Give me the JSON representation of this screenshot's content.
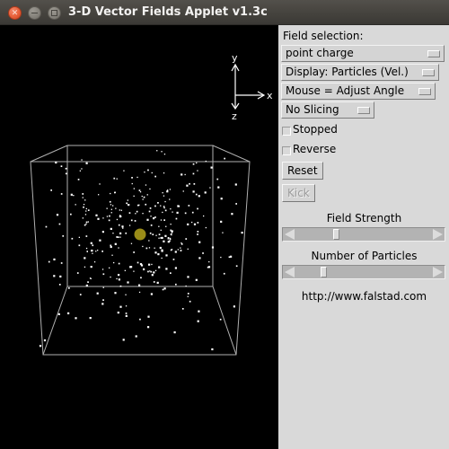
{
  "window": {
    "title": "3-D Vector Fields Applet v1.3c",
    "controls": {
      "close": "close-button",
      "minimize": "minimize-button",
      "maximize": "maximize-button"
    }
  },
  "canvas": {
    "background": "#000000",
    "axes": {
      "x_label": "x",
      "y_label": "y",
      "z_label": "z"
    },
    "point_charge_color": "#9a8c18",
    "particle_color": "#ffffff",
    "box_color": "#b4b4b4",
    "particle_count": 360
  },
  "panel": {
    "background": "#d9d9d9",
    "field_selection_label": "Field selection:",
    "field_dropdown": {
      "value": "point charge",
      "options": [
        "point charge"
      ]
    },
    "display_dropdown": {
      "value": "Display: Particles (Vel.)",
      "options": [
        "Display: Particles (Vel.)"
      ]
    },
    "mouse_dropdown": {
      "value": "Mouse = Adjust Angle",
      "options": [
        "Mouse = Adjust Angle"
      ]
    },
    "slicing_dropdown": {
      "value": "No Slicing",
      "options": [
        "No Slicing"
      ]
    },
    "stopped_checkbox": {
      "label": "Stopped",
      "checked": false
    },
    "reverse_checkbox": {
      "label": "Reverse",
      "checked": false
    },
    "reset_button": {
      "label": "Reset",
      "enabled": true
    },
    "kick_button": {
      "label": "Kick",
      "enabled": false
    },
    "field_strength": {
      "label": "Field Strength",
      "value_percent": 28
    },
    "number_of_particles": {
      "label": "Number of Particles",
      "value_percent": 18
    },
    "url": "http://www.falstad.com"
  }
}
